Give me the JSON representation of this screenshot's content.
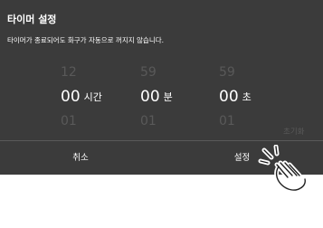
{
  "dialog": {
    "title": "타이머 설정",
    "description": "타이머가 종료되어도 화구가 자동으로 꺼지지 않습니다.",
    "reset_label": "초기화",
    "cancel_label": "취소",
    "confirm_label": "설정"
  },
  "picker": {
    "hours": {
      "prev": "12",
      "value": "00",
      "unit": "시간",
      "next": "01"
    },
    "minutes": {
      "prev": "59",
      "value": "00",
      "unit": "분",
      "next": "01"
    },
    "seconds": {
      "prev": "59",
      "value": "00",
      "unit": "초",
      "next": "01"
    }
  },
  "colors": {
    "dialog_bg": "#3b3b3b",
    "text": "#ffffff",
    "muted": "#595959",
    "background": "#ffffff"
  },
  "icons": {
    "pointer": "tap-hand-icon"
  }
}
